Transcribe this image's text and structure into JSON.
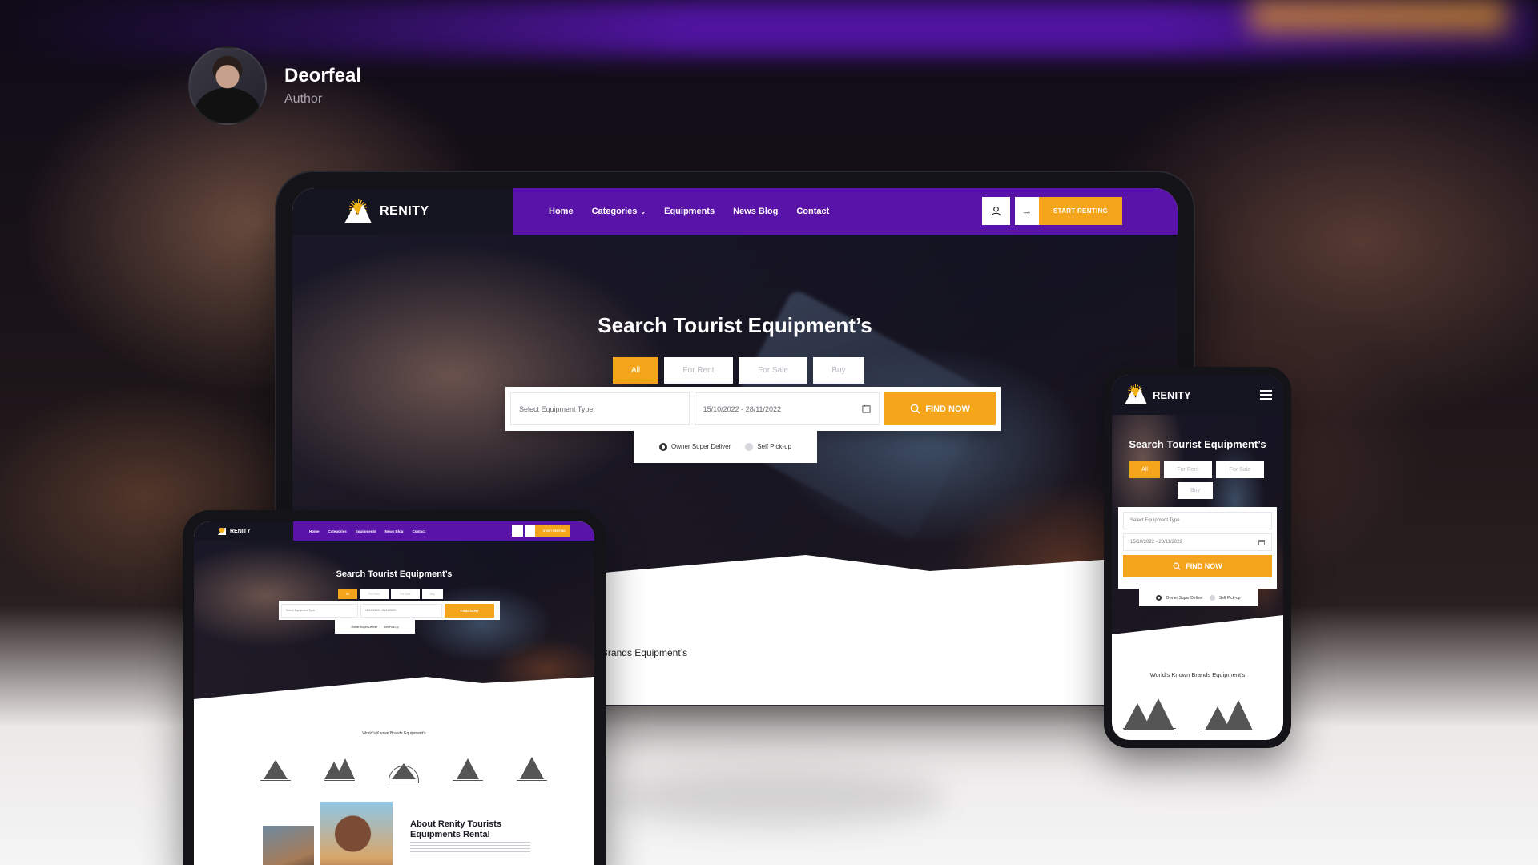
{
  "author": {
    "name": "Deorfeal",
    "role": "Author"
  },
  "site": {
    "brand": "RENITY",
    "nav": [
      {
        "label": "Home"
      },
      {
        "label": "Categories",
        "has_dropdown": true
      },
      {
        "label": "Equipments"
      },
      {
        "label": "News Blog"
      },
      {
        "label": "Contact"
      }
    ],
    "cta": "START RENTING",
    "hero_title": "Search Tourist Equipment’s",
    "tabs": [
      "All",
      "For Rent",
      "For Sale",
      "Buy"
    ],
    "active_tab": "All",
    "search": {
      "type_placeholder": "Select Equipment Type",
      "date_range": "15/10/2022 - 28/11/2022",
      "button": "FIND NOW"
    },
    "delivery": {
      "option1": "Owner Super Deliver",
      "option2": "Self Pick-up",
      "selected": "Owner Super Deliver"
    },
    "brands_title": "World’s Known Brands Equipment’s",
    "about": {
      "title": "About Renity Tourists Equipments Rental"
    }
  },
  "colors": {
    "purple": "#5a13a8",
    "orange": "#f4a51c",
    "dark": "#151421"
  },
  "icons": [
    "user-icon",
    "arrow-right-icon",
    "calendar-icon",
    "search-icon",
    "menu-icon",
    "chevron-down-icon"
  ]
}
